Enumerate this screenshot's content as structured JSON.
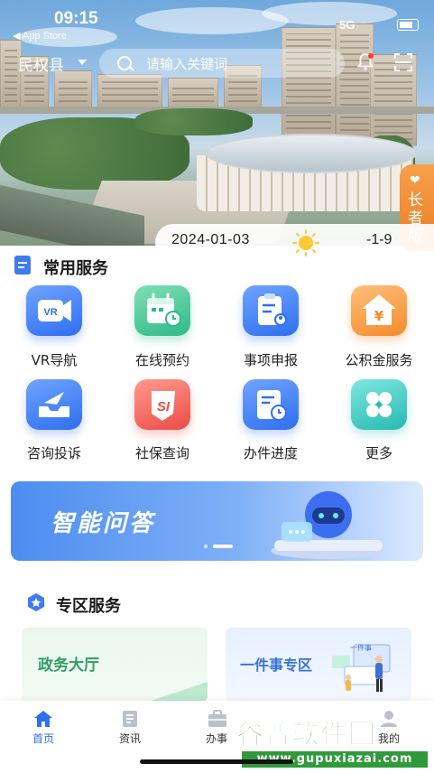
{
  "status_bar": {
    "time": "09:15",
    "back_label": "◀ App Store",
    "signal": "5G",
    "battery_text": "54"
  },
  "header": {
    "county": "民权县",
    "search_placeholder": "请输入关键词"
  },
  "elder_mode": {
    "label": "长者版"
  },
  "weather": {
    "date": "2024-01-03",
    "temperature": "-1-9"
  },
  "common_services": {
    "title": "常用服务",
    "items": [
      {
        "label": "VR导航",
        "icon": "vr-icon",
        "color": "#2f6ef0"
      },
      {
        "label": "在线预约",
        "icon": "calendar-clock-icon",
        "color": "#2fb98a"
      },
      {
        "label": "事项申报",
        "icon": "clipboard-user-icon",
        "color": "#2f6ef0"
      },
      {
        "label": "公积金服务",
        "icon": "house-yuan-icon",
        "color": "#f58a2a"
      },
      {
        "label": "咨询投诉",
        "icon": "inbox-send-icon",
        "color": "#2f6ef0"
      },
      {
        "label": "社保查询",
        "icon": "social-security-icon",
        "color": "#ec4b45"
      },
      {
        "label": "办件进度",
        "icon": "document-clock-icon",
        "color": "#2f6ef0"
      },
      {
        "label": "更多",
        "icon": "four-leaf-icon",
        "color": "#27b9b2"
      }
    ]
  },
  "banner": {
    "text": "智能问答"
  },
  "zone_services": {
    "title": "专区服务",
    "cards": [
      {
        "label": "政务大厅"
      },
      {
        "label": "一件事专区",
        "illustration_text": "一件事"
      }
    ]
  },
  "tab_bar": {
    "tabs": [
      {
        "label": "首页",
        "active": true
      },
      {
        "label": "资讯",
        "active": false
      },
      {
        "label": "办事",
        "active": false
      },
      {
        "label": "我的",
        "active": false
      }
    ],
    "active_color": "#2f6ef0"
  },
  "watermark": {
    "brand": "谷普软件园",
    "url": "www.gupuxiazai.com"
  }
}
